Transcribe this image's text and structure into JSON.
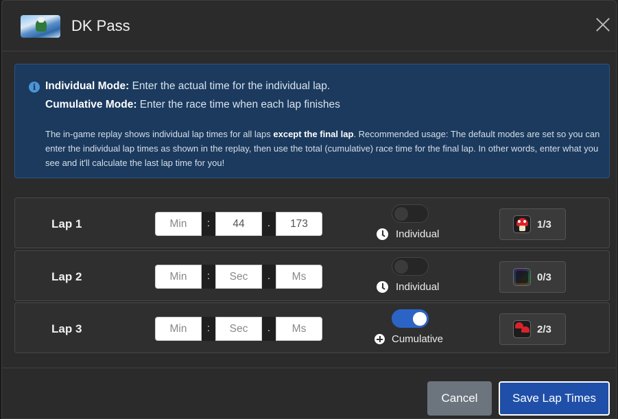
{
  "modal": {
    "title": "DK Pass",
    "thumbnail_icon": "track-thumbnail",
    "close_icon": "close-icon"
  },
  "info": {
    "icon": "info-icon",
    "individual_mode_label": "Individual Mode:",
    "individual_mode_text": " Enter the actual time for the individual lap.",
    "cumulative_mode_label": "Cumulative Mode:",
    "cumulative_mode_text": " Enter the race time when each lap finishes",
    "para_part1": "The in-game replay shows individual lap times for all laps ",
    "para_bold": "except the final lap",
    "para_part2": ". Recommended usage: The default modes are set so you can enter the individual lap times as shown in the replay, then use the total (cumulative) race time for the final lap. In other words, enter what you see and it'll calculate the last lap time for you!"
  },
  "laps": [
    {
      "label": "Lap 1",
      "min": {
        "value": "",
        "placeholder": "Min"
      },
      "sec": {
        "value": "44",
        "placeholder": "Sec"
      },
      "ms": {
        "value": "173",
        "placeholder": "Ms"
      },
      "mode_on": false,
      "mode_label": "Individual",
      "mode_icon": "clock-icon",
      "item_icon": "mushroom-icon",
      "item_count": "1/3"
    },
    {
      "label": "Lap 2",
      "min": {
        "value": "",
        "placeholder": "Min"
      },
      "sec": {
        "value": "",
        "placeholder": "Sec"
      },
      "ms": {
        "value": "",
        "placeholder": "Ms"
      },
      "mode_on": false,
      "mode_label": "Individual",
      "mode_icon": "clock-icon",
      "item_icon": "no-item-icon",
      "item_count": "0/3"
    },
    {
      "label": "Lap 3",
      "min": {
        "value": "",
        "placeholder": "Min"
      },
      "sec": {
        "value": "",
        "placeholder": "Sec"
      },
      "ms": {
        "value": "",
        "placeholder": "Ms"
      },
      "mode_on": true,
      "mode_label": "Cumulative",
      "mode_icon": "plus-circle-icon",
      "item_icon": "double-mushroom-icon",
      "item_count": "2/3"
    }
  ],
  "separators": {
    "colon": ":",
    "dot": "."
  },
  "footer": {
    "cancel_label": "Cancel",
    "save_label": "Save Lap Times"
  },
  "colors": {
    "info_bg": "#1b3a5e",
    "primary": "#1f4fa8",
    "secondary": "#6c757d",
    "toggle_on": "#2b64c5"
  }
}
